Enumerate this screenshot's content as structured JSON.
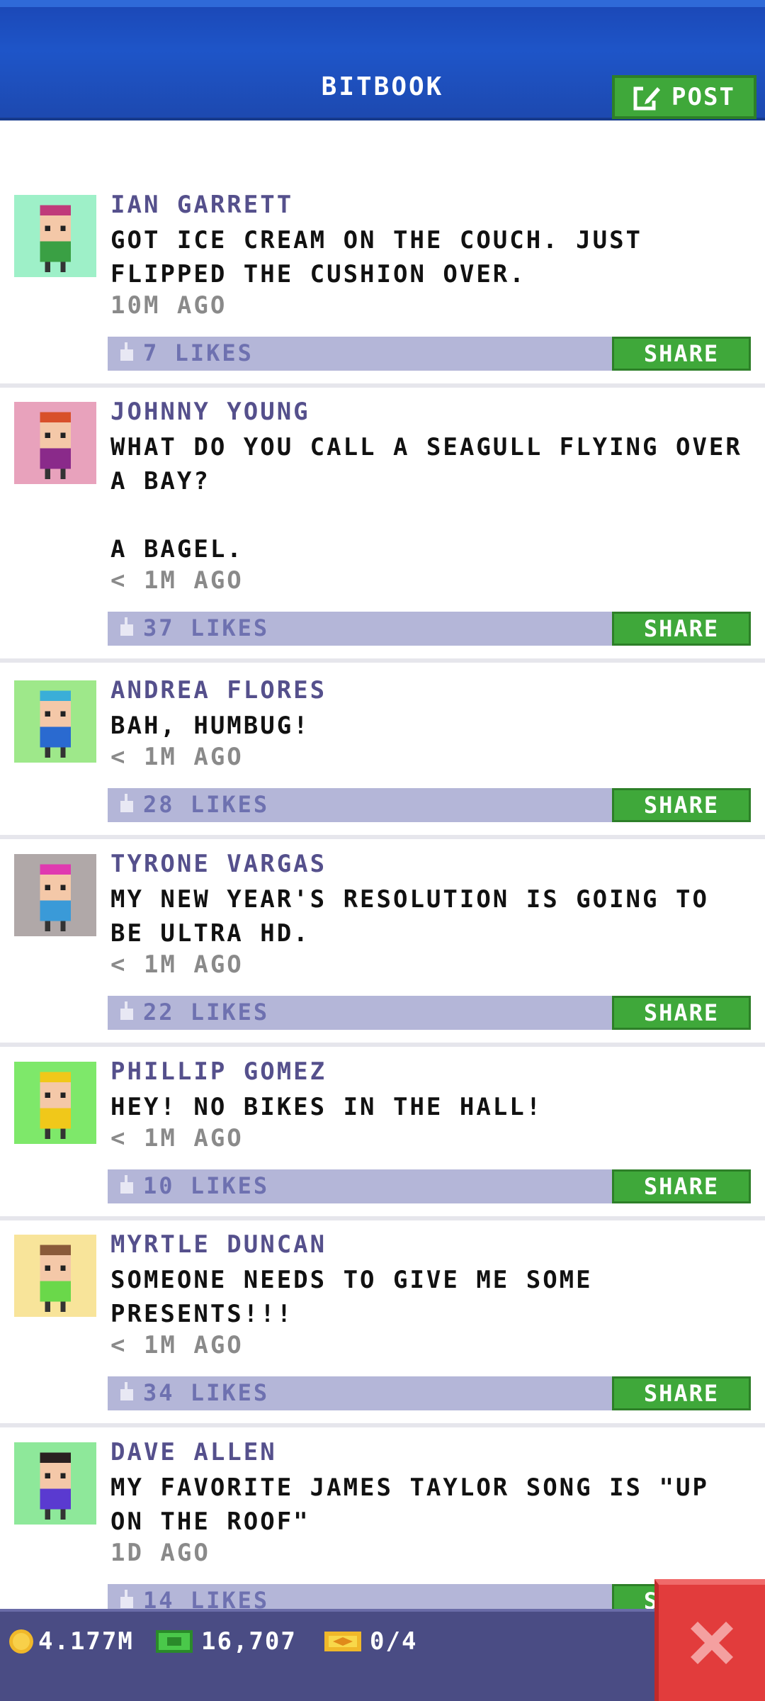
{
  "header": {
    "title": "BITBOOK",
    "post_label": "POST"
  },
  "posts": [
    {
      "name": "IAN GARRETT",
      "message": "GOT ICE CREAM ON THE COUCH. JUST FLIPPED THE CUSHION OVER.",
      "time": "10M AGO",
      "likes": "7 LIKES",
      "share": "SHARE",
      "avatar_bg": "#9ef0c8",
      "shirt": "#3aa044",
      "hair": "#c03a7a"
    },
    {
      "name": "JOHNNY YOUNG",
      "message": "WHAT DO YOU CALL A SEAGULL FLYING OVER A BAY?\n\nA BAGEL.",
      "time": "< 1M AGO",
      "likes": "37 LIKES",
      "share": "SHARE",
      "avatar_bg": "#e8a2bc",
      "shirt": "#8a2a8a",
      "hair": "#d8502a"
    },
    {
      "name": "ANDREA FLORES",
      "message": "BAH, HUMBUG!",
      "time": "< 1M AGO",
      "likes": "28 LIKES",
      "share": "SHARE",
      "avatar_bg": "#9ee88a",
      "shirt": "#2a6ad0",
      "hair": "#3aaed8"
    },
    {
      "name": "TYRONE VARGAS",
      "message": "MY NEW YEAR'S RESOLUTION IS GOING TO BE ULTRA HD.",
      "time": "< 1M AGO",
      "likes": "22 LIKES",
      "share": "SHARE",
      "avatar_bg": "#b0a8a8",
      "shirt": "#3a9ad8",
      "hair": "#e03ab0"
    },
    {
      "name": "PHILLIP GOMEZ",
      "message": "HEY! NO BIKES IN THE HALL!",
      "time": "< 1M AGO",
      "likes": "10 LIKES",
      "share": "SHARE",
      "avatar_bg": "#7ee86a",
      "shirt": "#f0c81a",
      "hair": "#f0c81a"
    },
    {
      "name": "MYRTLE DUNCAN",
      "message": "SOMEONE NEEDS TO GIVE ME SOME PRESENTS!!!",
      "time": "< 1M AGO",
      "likes": "34 LIKES",
      "share": "SHARE",
      "avatar_bg": "#f8e49a",
      "shirt": "#6ad84a",
      "hair": "#8a5a3a"
    },
    {
      "name": "DAVE ALLEN",
      "message": "MY FAVORITE JAMES TAYLOR SONG IS \"UP ON THE ROOF\"",
      "time": "1D AGO",
      "likes": "14 LIKES",
      "share": "SHARE",
      "avatar_bg": "#8ee89a",
      "shirt": "#5a3ad0",
      "hair": "#2a2020"
    }
  ],
  "bottom_bar": {
    "coins": "4.177M",
    "bux": "16,707",
    "tickets": "0/4"
  },
  "colors": {
    "header_blue": "#1e55c8",
    "button_green": "#3fa83a",
    "like_bar": "#b4b6d8",
    "name_purple": "#55508c",
    "close_red": "#e23c3c"
  }
}
